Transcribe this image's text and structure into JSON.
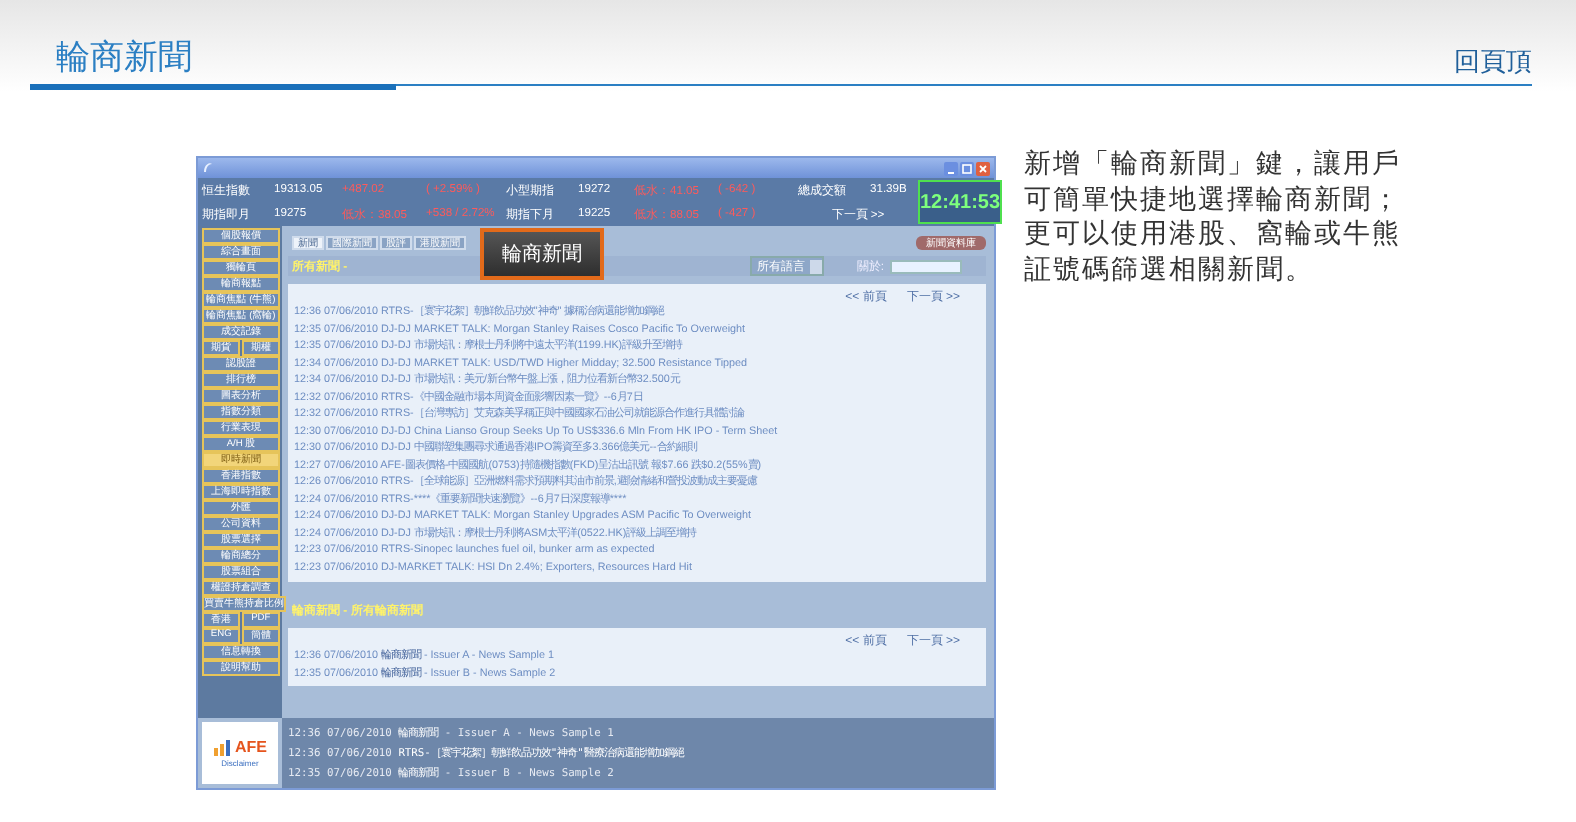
{
  "header": {
    "title": "輪商新聞",
    "back_to_top": "回頁頂"
  },
  "app_window": {
    "ticker_rows": [
      {
        "cells": [
          {
            "kind": "label",
            "text": "恒生指數"
          },
          {
            "kind": "value",
            "text": "19313.05"
          },
          {
            "kind": "change",
            "text": "+487.02"
          },
          {
            "kind": "change",
            "text": "( +2.59% )"
          },
          {
            "kind": "label",
            "text": "小型期指"
          },
          {
            "kind": "value",
            "text": "19272"
          },
          {
            "kind": "change",
            "text": "低水：41.05"
          },
          {
            "kind": "change",
            "text": "( -642 )"
          },
          {
            "kind": "label",
            "text": "總成交額"
          },
          {
            "kind": "value",
            "text": "31.39B"
          }
        ]
      },
      {
        "cells": [
          {
            "kind": "label",
            "text": "期指即月"
          },
          {
            "kind": "value",
            "text": "19275"
          },
          {
            "kind": "change",
            "text": "低水：38.05"
          },
          {
            "kind": "change",
            "text": "+538 / 2.72%"
          },
          {
            "kind": "label",
            "text": "期指下月"
          },
          {
            "kind": "value",
            "text": "19225"
          },
          {
            "kind": "change",
            "text": "低水：88.05"
          },
          {
            "kind": "change",
            "text": "( -427 )"
          },
          {
            "kind": "link",
            "text": "下一頁 >>"
          }
        ]
      }
    ],
    "clock": "12:41:53",
    "sidebar": [
      {
        "labels": [
          "個股報價"
        ],
        "selected": false
      },
      {
        "labels": [
          "綜合畫面"
        ],
        "selected": false
      },
      {
        "labels": [
          "獨輪頁"
        ],
        "selected": false
      },
      {
        "labels": [
          "輪商報點"
        ],
        "selected": false
      },
      {
        "labels": [
          "輪商焦點 (牛熊)"
        ],
        "selected": false
      },
      {
        "labels": [
          "輪商焦點 (窩輪)"
        ],
        "selected": false
      },
      {
        "labels": [
          "成交記錄"
        ],
        "selected": false
      },
      {
        "labels": [
          "期貨",
          "期權"
        ],
        "selected": false
      },
      {
        "labels": [
          "認股證"
        ],
        "selected": false
      },
      {
        "labels": [
          "排行榜"
        ],
        "selected": false
      },
      {
        "labels": [
          "圖表分析"
        ],
        "selected": false
      },
      {
        "labels": [
          "指數分類"
        ],
        "selected": false
      },
      {
        "labels": [
          "行業表現"
        ],
        "selected": false
      },
      {
        "labels": [
          "A/H 股"
        ],
        "selected": false
      },
      {
        "labels": [
          "即時新聞"
        ],
        "selected": true
      },
      {
        "labels": [
          "香港指數"
        ],
        "selected": false
      },
      {
        "labels": [
          "上海即時指數"
        ],
        "selected": false
      },
      {
        "labels": [
          "外匯"
        ],
        "selected": false
      },
      {
        "labels": [
          "公司資料"
        ],
        "selected": false
      },
      {
        "labels": [
          "股票選擇"
        ],
        "selected": false
      },
      {
        "labels": [
          "輪商總分"
        ],
        "selected": false
      },
      {
        "labels": [
          "股票組合"
        ],
        "selected": false
      },
      {
        "labels": [
          "權證持倉調查"
        ],
        "selected": false
      },
      {
        "labels": [
          "買賣牛熊持倉比例"
        ],
        "selected": false
      },
      {
        "labels": [
          "香港",
          "PDF"
        ],
        "selected": false
      },
      {
        "labels": [
          "ENG",
          "簡體"
        ],
        "selected": false
      },
      {
        "labels": [
          "信息轉換"
        ],
        "selected": false
      },
      {
        "labels": [
          "說明幫助"
        ],
        "selected": false
      }
    ],
    "tabs": [
      {
        "label": "新聞",
        "selected": true
      },
      {
        "label": "國際新聞",
        "selected": false
      },
      {
        "label": "股評",
        "selected": false
      },
      {
        "label": "港股新聞",
        "selected": false
      }
    ],
    "popup_button": "輪商新聞",
    "database_button": "新聞資料庫",
    "news_section": {
      "heading": "所有新聞 -",
      "language_select": "所有語言",
      "search_label": "關於:",
      "prev": "<< 前頁",
      "next": "下一頁 >>",
      "items": [
        {
          "time": "12:36 07/06/2010",
          "text": "RTRS-［寰宇花絮］朝鮮飲品功效\"神奇\" 據稱治病還能增加鋼絕"
        },
        {
          "time": "12:35 07/06/2010",
          "text": "DJ-DJ MARKET TALK: Morgan Stanley Raises Cosco Pacific To Overweight"
        },
        {
          "time": "12:35 07/06/2010",
          "text": "DJ-DJ 市場快訊：摩根士丹利將中遠太平洋(1199.HK)評級升至增持"
        },
        {
          "time": "12:34 07/06/2010",
          "text": "DJ-DJ MARKET TALK: USD/TWD Higher Midday; 32.500 Resistance Tipped"
        },
        {
          "time": "12:34 07/06/2010",
          "text": "DJ-DJ 市場快訊：美元/新台幣午盤上漲，阻力位看新台幣32.500元"
        },
        {
          "time": "12:32 07/06/2010",
          "text": "RTRS-《中國金融市場本周資金面影響因素一覽》--6月7日"
        },
        {
          "time": "12:32 07/06/2010",
          "text": "RTRS-［台灣專訪］艾克森美孚稱正與中國國家石油公司就能源合作進行具體討論"
        },
        {
          "time": "12:30 07/06/2010",
          "text": "DJ-DJ China Lianso Group Seeks Up To US$336.6 Mln From HK IPO - Term Sheet"
        },
        {
          "time": "12:30 07/06/2010",
          "text": "DJ-DJ 中國聯塑集團尋求通過香港IPO籌資至多3.366億美元--合約細則"
        },
        {
          "time": "12:27 07/06/2010",
          "text": "AFE-圖表價格-中國國航(0753)持隨機指數(FKD)呈沽出訊號 報$7.66 跌$0.2(55%賣)"
        },
        {
          "time": "12:26 07/06/2010",
          "text": "RTRS-［全球能源］亞洲燃料需求預期料其油市前景,避險情緒和營投波動成主要憂慮"
        },
        {
          "time": "12:24 07/06/2010",
          "text": "RTRS-****《重要新聞快速瀏覽》--6月7日深度報導****"
        },
        {
          "time": "12:24 07/06/2010",
          "text": "DJ-DJ MARKET TALK: Morgan Stanley Upgrades ASM Pacific To Overweight"
        },
        {
          "time": "12:24 07/06/2010",
          "text": "DJ-DJ 市場快訊：摩根士丹利將ASM太平洋(0522.HK)評級上調至增持"
        },
        {
          "time": "12:23 07/06/2010",
          "text": "RTRS-Sinopec launches fuel oil, bunker arm as expected"
        },
        {
          "time": "12:23 07/06/2010",
          "text": "DJ-MARKET TALK: HSI Dn 2.4%; Exporters, Resources Hard Hit"
        }
      ]
    },
    "issuer_section": {
      "heading": "輪商新聞 - 所有輪商新聞",
      "prev": "<< 前頁",
      "next": "下一頁 >>",
      "items": [
        {
          "time": "12:36 07/06/2010",
          "source": "輪商新聞",
          "text": " - Issuer A - News Sample 1"
        },
        {
          "time": "12:35 07/06/2010",
          "source": "輪商新聞",
          "text": " - Issuer B - News Sample 2"
        }
      ]
    },
    "bottom_ticker": [
      {
        "time": "12:36 07/06/2010",
        "source": "輪商新聞",
        "text": " - Issuer A - News Sample 1"
      },
      {
        "time": "12:36 07/06/2010",
        "source": "RTRS-［寰宇花絮］朝鮮飲品功效\"神奇\"醫療治病還能增加鋼絕"
      },
      {
        "time": "12:35 07/06/2010",
        "source": "輪商新聞",
        "text": " - Issuer B - News Sample 2"
      }
    ],
    "logo": "AFE",
    "disclaimer": "Disclaimer"
  },
  "blurb": "新增「輪商新聞」鍵，讓用戶可簡單快捷地選擇輪商新聞；更可以使用港股、窩輪或牛熊証號碼篩選相關新聞。"
}
